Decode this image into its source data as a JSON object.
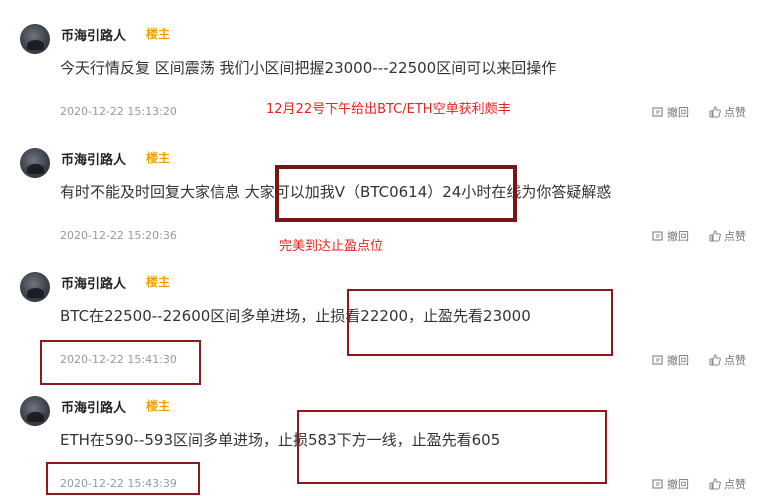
{
  "posts": [
    {
      "username": "币海引路人",
      "badge": "楼主",
      "content": "今天行情反复 区间震荡 我们小区间把握23000---22500区间可以来回操作",
      "time": "2020-12-22 15:13:20",
      "undo_label": "撤回",
      "like_label": "点赞"
    },
    {
      "username": "币海引路人",
      "badge": "楼主",
      "content": "有时不能及时回复大家信息 大家可以加我V（BTC0614）24小时在线为你答疑解惑",
      "time": "2020-12-22 15:20:36",
      "undo_label": "撤回",
      "like_label": "点赞"
    },
    {
      "username": "币海引路人",
      "badge": "楼主",
      "content": "BTC在22500--22600区间多单进场，止损看22200，止盈先看23000",
      "time": "2020-12-22 15:41:30",
      "undo_label": "撤回",
      "like_label": "点赞"
    },
    {
      "username": "币海引路人",
      "badge": "楼主",
      "content": "ETH在590--593区间多单进场，止损583下方一线，止盈先看605",
      "time": "2020-12-22 15:43:39",
      "undo_label": "撤回",
      "like_label": "点赞"
    }
  ],
  "annotations": {
    "top": "12月22号下午给出BTC/ETH空单获利颇丰",
    "mid": "完美到达止盈点位"
  },
  "colors": {
    "badge": "#f0a100",
    "annotation": "#e8231e",
    "box": "#8b1a1a"
  }
}
